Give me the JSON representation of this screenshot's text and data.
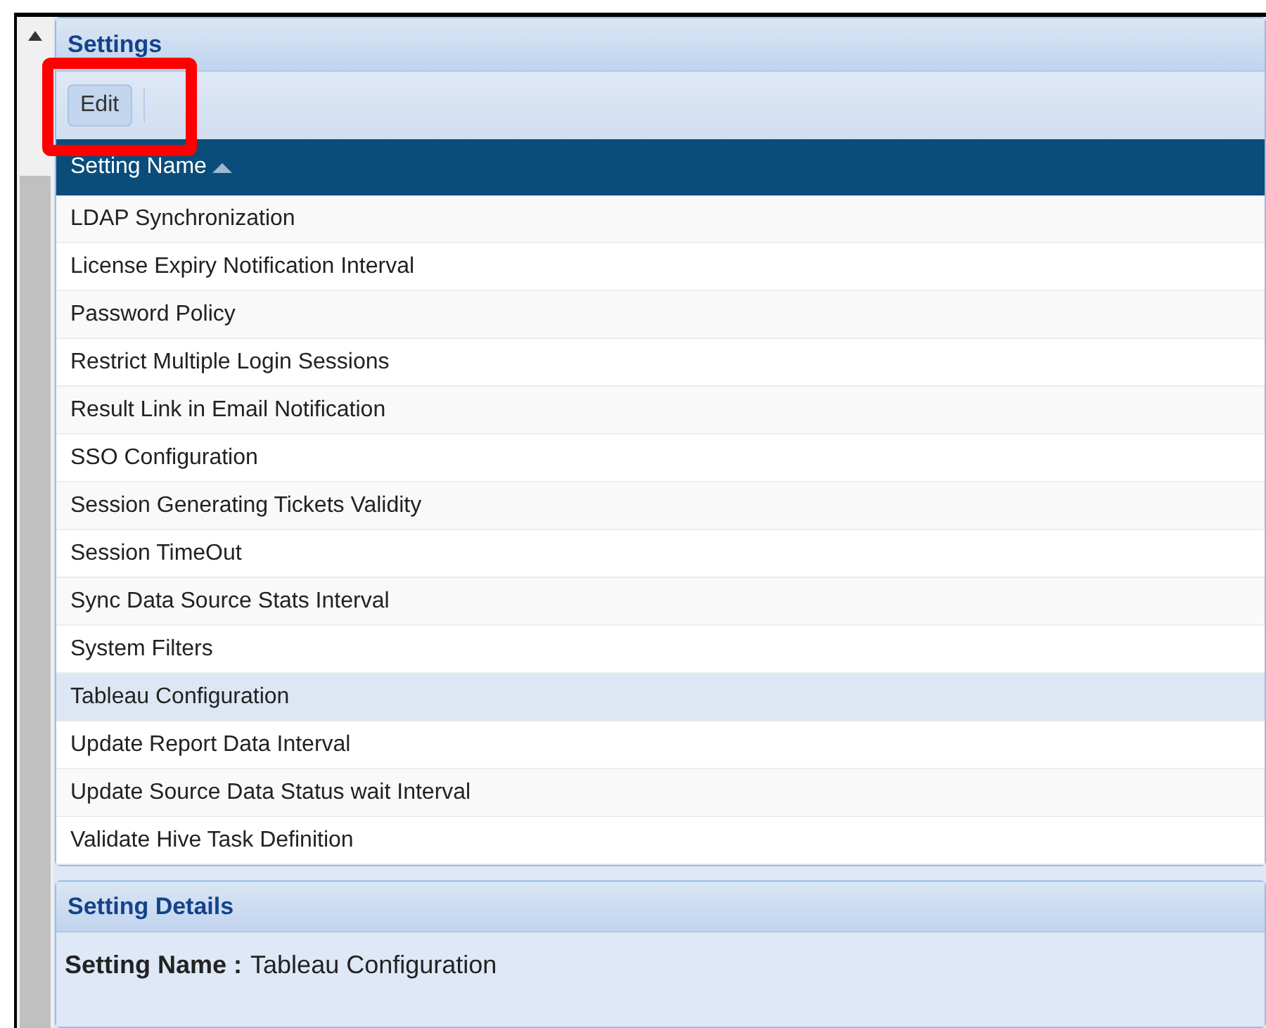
{
  "settings_panel": {
    "title": "Settings",
    "toolbar": {
      "edit_button": "Edit",
      "highlighted": true
    },
    "table": {
      "columns": [
        {
          "label": "Setting Name",
          "sorted_ascending": true
        }
      ],
      "rows": [
        {
          "name": "LDAP Synchronization",
          "selected": false
        },
        {
          "name": "License Expiry Notification Interval",
          "selected": false
        },
        {
          "name": "Password Policy",
          "selected": false
        },
        {
          "name": "Restrict Multiple Login Sessions",
          "selected": false
        },
        {
          "name": "Result Link in Email Notification",
          "selected": false
        },
        {
          "name": "SSO Configuration",
          "selected": false
        },
        {
          "name": "Session Generating Tickets Validity",
          "selected": false
        },
        {
          "name": "Session TimeOut",
          "selected": false
        },
        {
          "name": "Sync Data Source Stats Interval",
          "selected": false
        },
        {
          "name": "System Filters",
          "selected": false
        },
        {
          "name": "Tableau Configuration",
          "selected": true
        },
        {
          "name": "Update Report Data Interval",
          "selected": false
        },
        {
          "name": "Update Source Data Status wait Interval",
          "selected": false
        },
        {
          "name": "Validate Hive Task Definition",
          "selected": false
        }
      ]
    }
  },
  "details_panel": {
    "title": "Setting Details",
    "field_label": "Setting Name :",
    "field_value": "Tableau Configuration"
  }
}
